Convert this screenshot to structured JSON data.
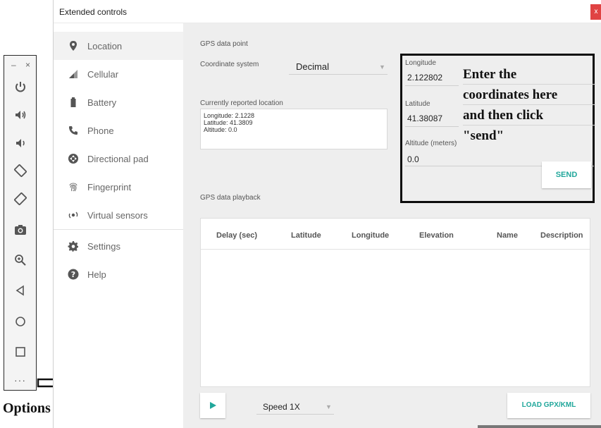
{
  "toolbar": {
    "minimize": "–",
    "close": "×",
    "more": "···",
    "icons": [
      "power-icon",
      "volume-up-icon",
      "volume-down-icon",
      "rotate-left-icon",
      "rotate-right-icon",
      "camera-icon",
      "zoom-icon",
      "back-icon",
      "home-icon",
      "overview-icon",
      "more-icon"
    ]
  },
  "options_label": "Options button",
  "window": {
    "title": "Extended controls",
    "close": "x"
  },
  "nav": {
    "items": [
      {
        "label": "Location",
        "icon": "location-pin-icon"
      },
      {
        "label": "Cellular",
        "icon": "signal-icon"
      },
      {
        "label": "Battery",
        "icon": "battery-icon"
      },
      {
        "label": "Phone",
        "icon": "phone-icon"
      },
      {
        "label": "Directional pad",
        "icon": "dpad-icon"
      },
      {
        "label": "Fingerprint",
        "icon": "fingerprint-icon"
      },
      {
        "label": "Virtual sensors",
        "icon": "sensors-icon"
      },
      {
        "label": "Settings",
        "icon": "gear-icon"
      },
      {
        "label": "Help",
        "icon": "help-icon"
      }
    ]
  },
  "gps_point": {
    "section_title": "GPS data point",
    "coord_system_label": "Coordinate system",
    "coord_system_value": "Decimal",
    "reported_label": "Currently reported location",
    "reported_lines": [
      "Longitude: 2.1228",
      "Latitude: 41.3809",
      "Altitude: 0.0"
    ],
    "longitude_label": "Longitude",
    "longitude_value": "2.122802",
    "latitude_label": "Latitude",
    "latitude_value": "41.38087",
    "altitude_label": "Altitude (meters)",
    "altitude_value": "0.0",
    "send_label": "SEND"
  },
  "annotation": {
    "lines": [
      "Enter the",
      "coordinates here",
      "and then click",
      "\"send\""
    ]
  },
  "playback": {
    "section_title": "GPS data playback",
    "columns": [
      "Delay (sec)",
      "Latitude",
      "Longitude",
      "Elevation",
      "Name",
      "Description"
    ],
    "speed_value": "Speed 1X",
    "load_label": "LOAD GPX/KML"
  },
  "colors": {
    "accent": "#21a79b",
    "close_red": "#e04343",
    "panel_gray": "#eeeeee",
    "annotation_border": "#0d0d0d"
  }
}
